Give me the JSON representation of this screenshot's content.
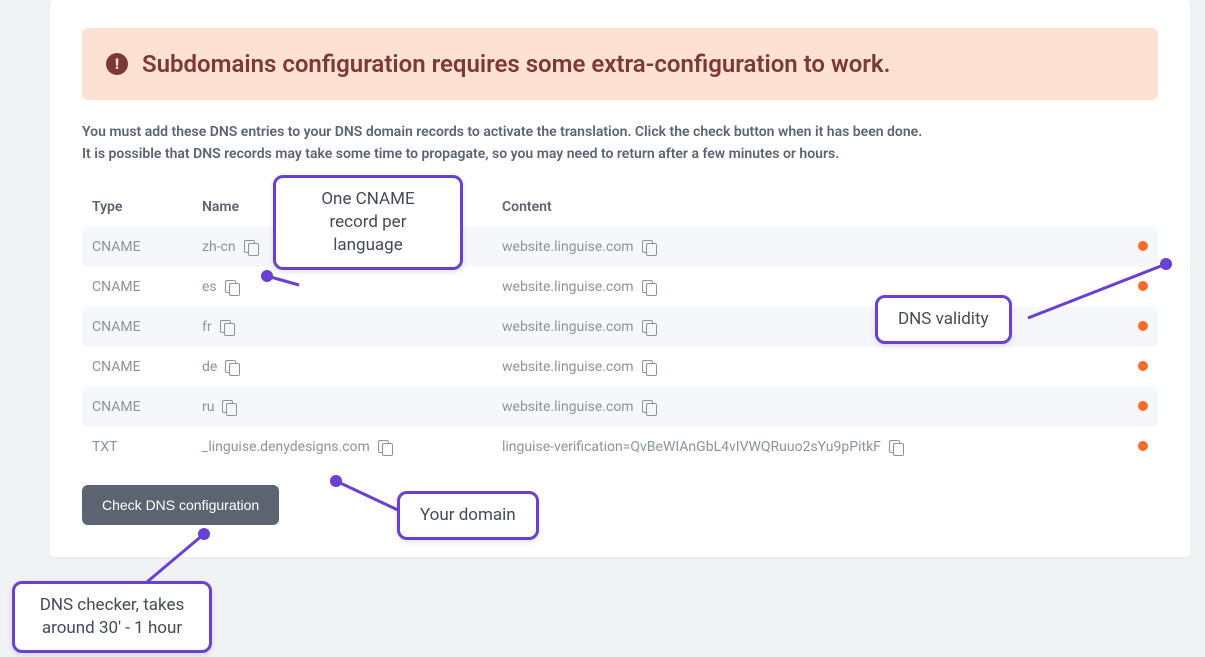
{
  "alert": {
    "icon_glyph": "!",
    "text": "Subdomains configuration requires some extra-configuration to work."
  },
  "instructions": {
    "line1": "You must add these DNS entries to your DNS domain records to activate the translation. Click the check button when it has been done.",
    "line2": "It is possible that DNS records may take some time to propagate, so you may need to return after a few minutes or hours."
  },
  "table": {
    "headers": {
      "type": "Type",
      "name": "Name",
      "content": "Content"
    },
    "rows": [
      {
        "type": "CNAME",
        "name": "zh-cn",
        "content": "website.linguise.com"
      },
      {
        "type": "CNAME",
        "name": "es",
        "content": "website.linguise.com"
      },
      {
        "type": "CNAME",
        "name": "fr",
        "content": "website.linguise.com"
      },
      {
        "type": "CNAME",
        "name": "de",
        "content": "website.linguise.com"
      },
      {
        "type": "CNAME",
        "name": "ru",
        "content": "website.linguise.com"
      },
      {
        "type": "TXT",
        "name": "_linguise.denydesigns.com",
        "content": "linguise-verification=QvBeWIAnGbL4vIVWQRuuo2sYu9pPitkF"
      }
    ]
  },
  "button": {
    "check_label": "Check DNS configuration"
  },
  "callouts": {
    "cname": "One CNAME record per language",
    "validity": "DNS validity",
    "domain": "Your domain",
    "checker": "DNS checker, takes around 30' - 1 hour"
  },
  "colors": {
    "accent": "#6a40d4",
    "status": "#ff6a2b",
    "alert_bg": "#fde1d3",
    "alert_fg": "#7b3a37"
  }
}
